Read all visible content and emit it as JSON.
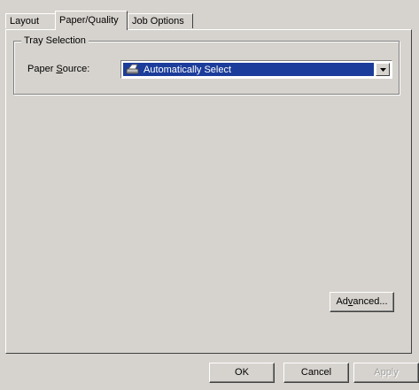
{
  "tabs": [
    {
      "label": "Layout",
      "active": false
    },
    {
      "label": "Paper/Quality",
      "active": true
    },
    {
      "label": "Job Options",
      "active": false
    }
  ],
  "tray_selection": {
    "title": "Tray Selection",
    "paper_source_label_pre": "Paper ",
    "paper_source_label_accel": "S",
    "paper_source_label_post": "ource:",
    "paper_source_value": "Automatically Select",
    "paper_source_icon": "printer-tray-icon"
  },
  "buttons": {
    "advanced_pre": "Ad",
    "advanced_accel": "v",
    "advanced_post": "anced...",
    "ok": "OK",
    "cancel": "Cancel",
    "apply": "Apply"
  },
  "colors": {
    "dialog_bg": "#d6d3ce",
    "selection_bg": "#1b3c9a"
  }
}
